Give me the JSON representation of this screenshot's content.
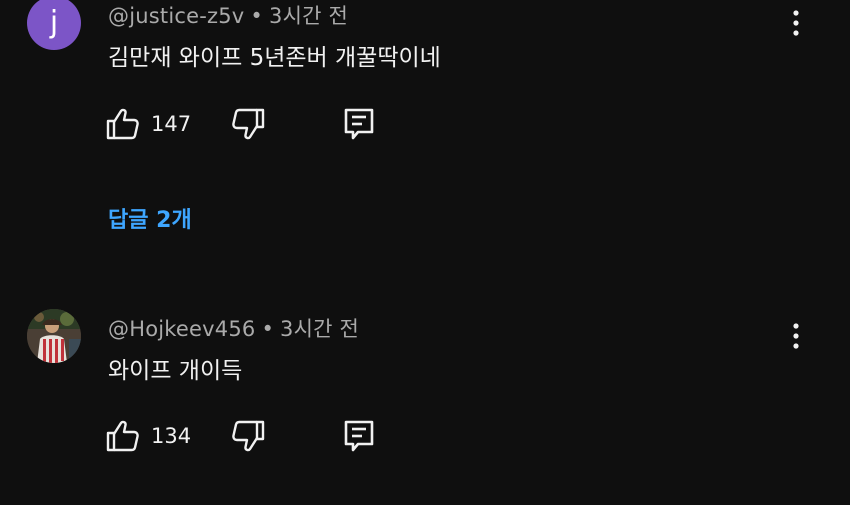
{
  "comments": [
    {
      "avatar_letter": "j",
      "avatar_color": "#7c55c7",
      "author": "@justice-z5v",
      "separator": "•",
      "time": "3시간 전",
      "text": "김만재 와이프 5년존버 개꿀딱이네",
      "like_count": "147",
      "replies_label": "답글 2개"
    },
    {
      "avatar_letter": "",
      "author": "@Hojkeev456",
      "separator": "•",
      "time": "3시간 전",
      "text": "와이프 개이득",
      "like_count": "134"
    }
  ],
  "icons": {
    "like": "thumbs-up-icon",
    "dislike": "thumbs-down-icon",
    "reply": "reply-comment-icon",
    "more": "more-vertical-icon"
  },
  "colors": {
    "background": "#0f0f0f",
    "link": "#3ea6ff",
    "secondary_text": "#aaaaaa"
  }
}
